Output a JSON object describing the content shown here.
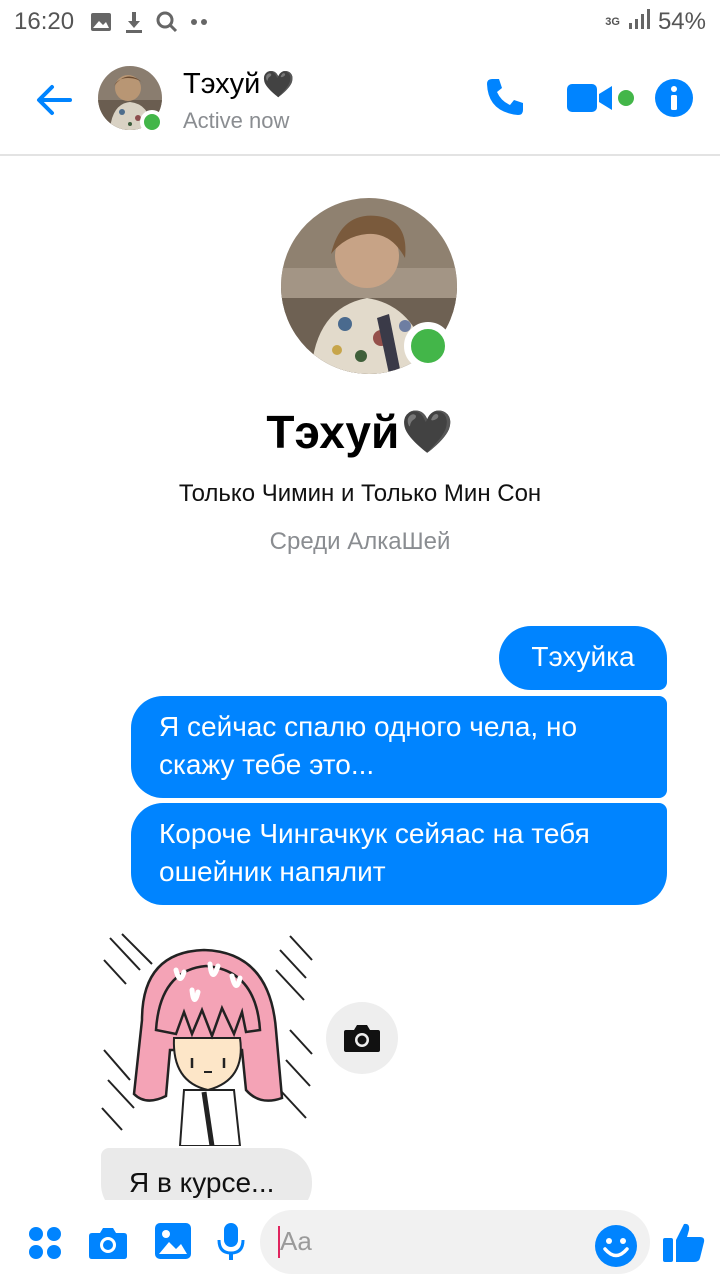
{
  "status_bar": {
    "time": "16:20",
    "network": "3G",
    "battery": "54%",
    "icons": [
      "gallery-icon",
      "download-icon",
      "search-icon",
      "more-dots-icon",
      "signal-icon"
    ]
  },
  "header": {
    "contact_name": "Тэхуй",
    "heart": "🖤",
    "status": "Active now"
  },
  "profile": {
    "name": "Тэхуй",
    "heart": "🖤",
    "subtitle": "Только Чимин и Только Мин Сон",
    "subtitle2": "Среди АлкаШей"
  },
  "messages": {
    "out1": "Тэхуйка",
    "out2": "Я сейчас спалю одного чела, но скажу тебе это...",
    "out3": "Короче Чингачкук сейяас на тебя ошейник напялит",
    "in1": "Я в курсе..."
  },
  "composer": {
    "placeholder": "Aa"
  },
  "colors": {
    "accent": "#0084ff",
    "online": "#43b649",
    "incoming_bubble": "#eaeaea"
  }
}
